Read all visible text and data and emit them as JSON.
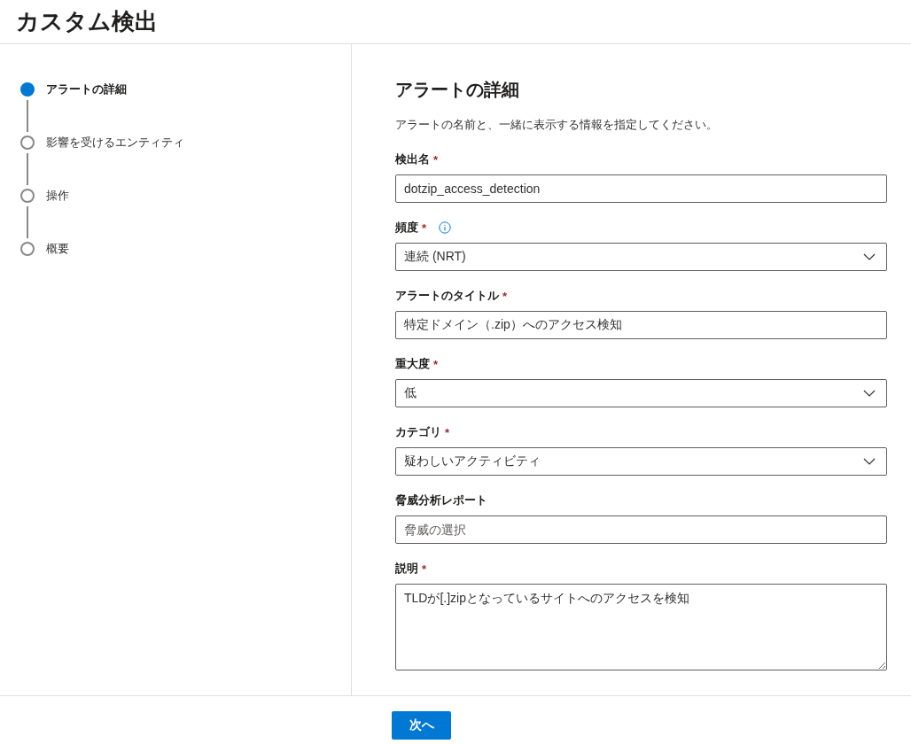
{
  "page": {
    "title": "カスタム検出"
  },
  "steps": [
    {
      "label": "アラートの詳細",
      "selected": true
    },
    {
      "label": "影響を受けるエンティティ",
      "selected": false
    },
    {
      "label": "操作",
      "selected": false
    },
    {
      "label": "概要",
      "selected": false
    }
  ],
  "form": {
    "heading": "アラートの詳細",
    "description": "アラートの名前と、一緒に表示する情報を指定してください。",
    "fields": [
      {
        "kind": "text",
        "label": "検出名",
        "required_mark": "*",
        "value": "dotzip_access_detection"
      },
      {
        "kind": "select",
        "label": "頻度",
        "required_mark": "*",
        "info": true,
        "value": "連続 (NRT)"
      },
      {
        "kind": "text",
        "label": "アラートのタイトル",
        "required_mark": "*",
        "value": "特定ドメイン（.zip）へのアクセス検知"
      },
      {
        "kind": "select",
        "label": "重大度",
        "required_mark": "*",
        "value": "低"
      },
      {
        "kind": "select",
        "label": "カテゴリ",
        "required_mark": "*",
        "value": "疑わしいアクティビティ"
      },
      {
        "kind": "text",
        "label": "脅威分析レポート",
        "placeholder": "脅威の選択"
      },
      {
        "kind": "textarea",
        "label": "説明",
        "required_mark": "*",
        "value": "TLDが[.]zipとなっているサイトへのアクセスを検知"
      }
    ]
  },
  "footer": {
    "next_button": "次へ"
  }
}
